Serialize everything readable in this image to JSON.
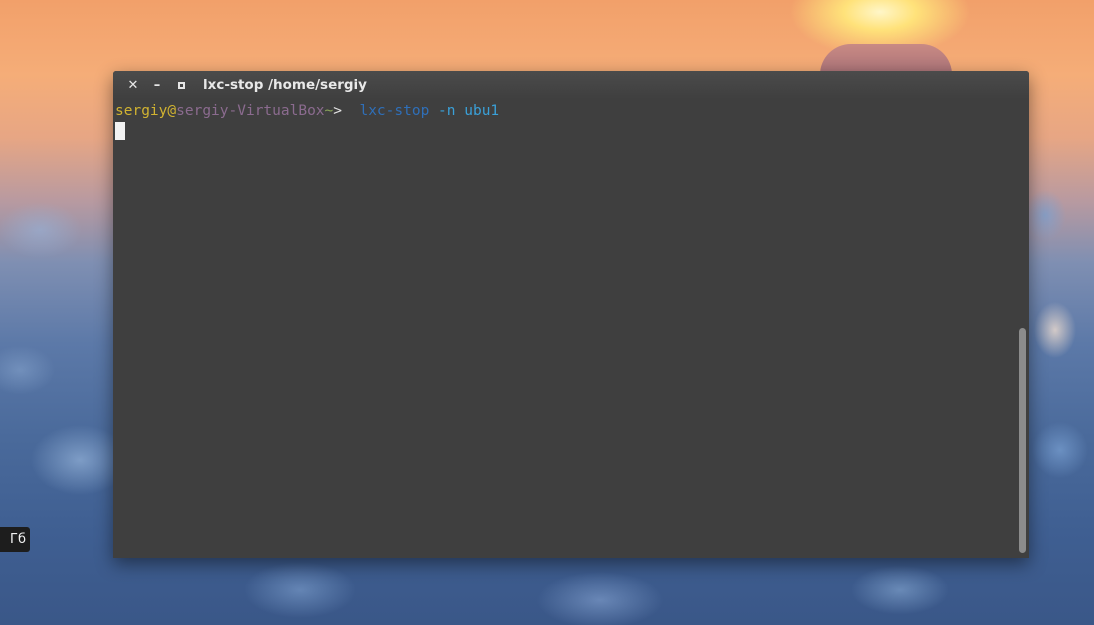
{
  "window": {
    "title": "lxc-stop  /home/sergiy",
    "controls": {
      "close": "✕",
      "minimize": "–"
    }
  },
  "terminal": {
    "prompt": {
      "user": "sergiy",
      "at": "@",
      "host": "sergiy-VirtualBox",
      "path": "~",
      "symbol": ">"
    },
    "command": "lxc-stop",
    "args": "-n ubu1"
  },
  "desktop": {
    "side_tooltip_text": "Гб"
  },
  "colors": {
    "terminal_bg": "#3f3f3f",
    "prompt_user": "#d1b331",
    "prompt_host": "#8b6b8f",
    "prompt_path": "#8aa45a",
    "command": "#2f6fb8",
    "args": "#3aa0d8"
  }
}
